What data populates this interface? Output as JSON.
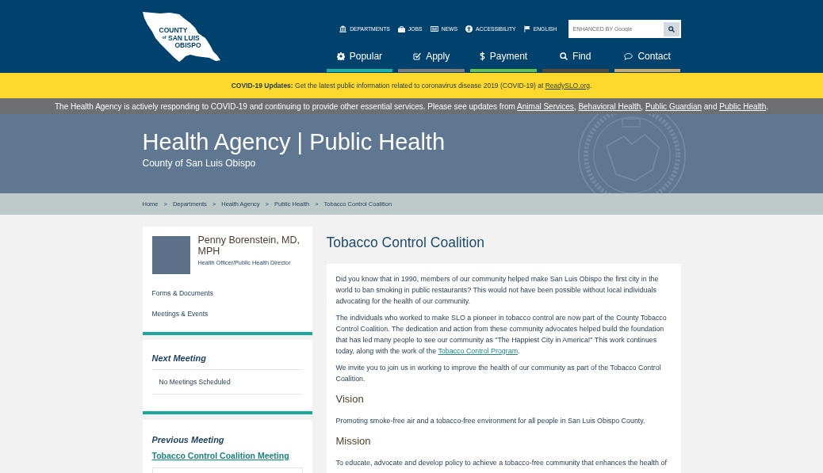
{
  "header": {
    "logo": {
      "lines": [
        "COUNTY",
        "of",
        "SAN LUIS",
        "OBISPO"
      ]
    },
    "utility_links": [
      {
        "kind": "departments",
        "label": "DEPARTMENTS"
      },
      {
        "kind": "jobs",
        "label": "JOBS"
      },
      {
        "kind": "news",
        "label": "NEWS"
      },
      {
        "kind": "accessibility",
        "label": "ACCESSIBILITY"
      },
      {
        "kind": "language",
        "label": "ENGLISH"
      }
    ],
    "search": {
      "placeholder": "ENHANCED BY Google"
    },
    "nav": [
      {
        "kind": "popular",
        "label": "Popular",
        "color": "#1ab3a6"
      },
      {
        "kind": "apply",
        "label": "Apply",
        "color": "#7d7d7d"
      },
      {
        "kind": "payment",
        "label": "Payment",
        "color": "#68c04b"
      },
      {
        "kind": "find",
        "label": "Find",
        "color": "#5e4a2e"
      },
      {
        "kind": "contact",
        "label": "Contact",
        "color": "#c9a86a"
      }
    ]
  },
  "covid_alert": {
    "parts": [
      {
        "kind": "text",
        "text": "**COVID-19 Updates:** Get the latest public information related to coronavirus disease 2019 (COVID-19) at "
      },
      {
        "kind": "link",
        "text": "ReadySLO.org"
      },
      {
        "kind": "text",
        "text": "."
      }
    ]
  },
  "notice": {
    "parts": [
      {
        "kind": "text",
        "text": "The Health Agency is actively responding to COVID-19 and continuing to provide other essential services. Please see updates from "
      },
      {
        "kind": "link",
        "text": "Animal Services"
      },
      {
        "kind": "text",
        "text": ", "
      },
      {
        "kind": "link",
        "text": "Behavioral Health"
      },
      {
        "kind": "text",
        "text": ", "
      },
      {
        "kind": "link",
        "text": "Public Guardian"
      },
      {
        "kind": "text",
        "text": " and "
      },
      {
        "kind": "link",
        "text": "Public Health"
      },
      {
        "kind": "text",
        "text": "."
      }
    ]
  },
  "banner": {
    "title": "Health Agency | Public Health",
    "subtitle": "County of San Luis Obispo"
  },
  "breadcrumb": [
    {
      "label": "Home"
    },
    {
      "separator": ">",
      "label": "Departments"
    },
    {
      "separator": ">",
      "label": "Health Agency"
    },
    {
      "separator": ">",
      "label": "Public Health"
    },
    {
      "separator": ">",
      "label": "Tobacco Control Coalition"
    }
  ],
  "sidebar": {
    "profile": {
      "name": "Penny Borenstein, MD, MPH",
      "role": "Health Officer/Public Health Director",
      "links": [
        "Forms & Documents",
        "Meetings & Events"
      ]
    },
    "next_meeting": {
      "heading": "Next Meeting",
      "items": [
        "No Meetings Scheduled"
      ]
    },
    "previous_meeting": {
      "heading": "Previous Meeting",
      "link": "Tobacco Control Coalition Meeting"
    }
  },
  "content": {
    "title": "Tobacco Control Coalition",
    "blocks": [
      {
        "kind": "paragraph",
        "parts": [
          {
            "kind": "text",
            "text": "Did you know that in 1990, members of our community helped make San Luis Obispo the first city in the world to ban smoking in public restaurants? This would not have been possible without local individuals advocating for the health of our community."
          }
        ]
      },
      {
        "kind": "paragraph",
        "parts": [
          {
            "kind": "text",
            "text": "The individuals who worked to make SLO a pioneer in tobacco control are now part of the County Tobacco Control Coalition. The dedication and action from these community advocates helped build the foundation that has led many people to see our community as \"The Happiest City in America!\" This work continues today, along with the work of the "
          },
          {
            "kind": "link",
            "text": "Tobacco Control Program"
          },
          {
            "kind": "text",
            "text": "."
          }
        ]
      },
      {
        "kind": "paragraph",
        "parts": [
          {
            "kind": "text",
            "text": "We invite you to join us in working to improve the health of our community as part of the Tobacco Control Coalition."
          }
        ]
      },
      {
        "kind": "heading",
        "text": "Vision"
      },
      {
        "kind": "paragraph",
        "parts": [
          {
            "kind": "text",
            "text": "Promoting smoke-free air and a tobacco-free environment for all people in San Luis Obispo County."
          }
        ]
      },
      {
        "kind": "heading",
        "text": "Mission"
      },
      {
        "kind": "paragraph",
        "parts": [
          {
            "kind": "text",
            "text": "To educate, advocate and develop policy to achieve a tobacco-free community that enhances the health of"
          }
        ]
      }
    ]
  }
}
